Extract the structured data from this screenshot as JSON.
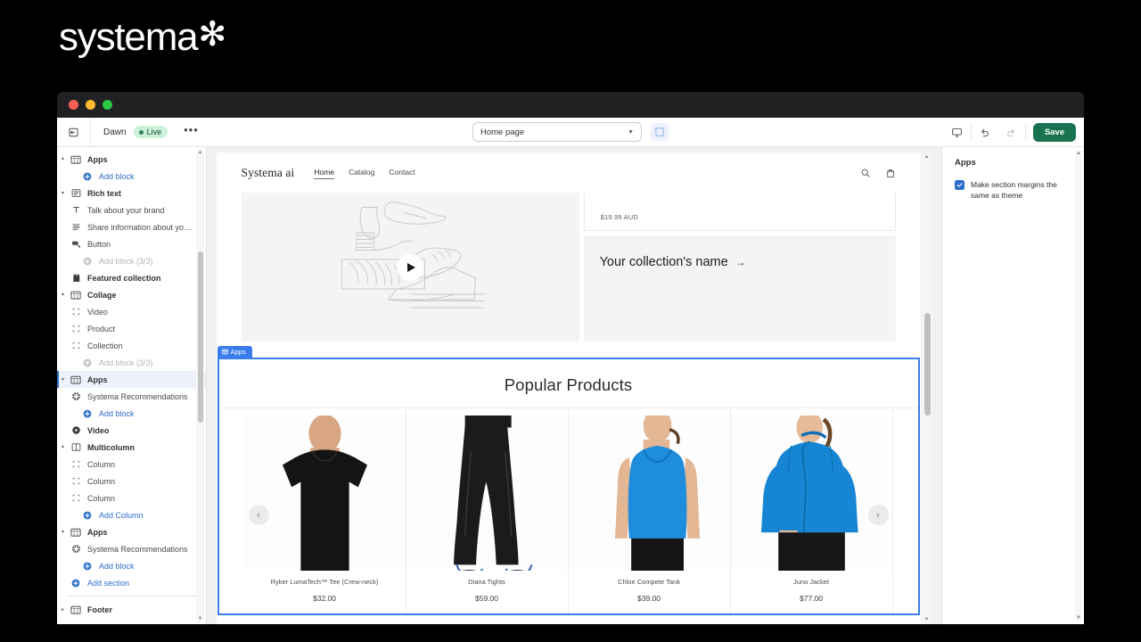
{
  "brand": {
    "name": "systema",
    "star": "✻"
  },
  "toolbar": {
    "exit_icon": "exit-icon",
    "theme_name": "Dawn",
    "live_label": "Live",
    "more_label": "•••",
    "page_selector_value": "Home page",
    "inspect_icon": "inspector-icon",
    "device_icon": "desktop-icon",
    "undo_icon": "undo-icon",
    "redo_icon": "redo-icon",
    "save_label": "Save"
  },
  "sidebar": {
    "items": [
      {
        "label": "Apps",
        "type": "section",
        "icon": "apps-icon",
        "twisty": "▾"
      },
      {
        "label": "Add block",
        "type": "add",
        "icon": "plus-circle-icon"
      },
      {
        "label": "Rich text",
        "type": "section",
        "icon": "richtext-icon",
        "twisty": "▾"
      },
      {
        "label": "Talk about your brand",
        "type": "block",
        "icon": "text-icon"
      },
      {
        "label": "Share information about yo…",
        "type": "block",
        "icon": "paragraph-icon"
      },
      {
        "label": "Button",
        "type": "block",
        "icon": "button-icon"
      },
      {
        "label": "Add block (3/3)",
        "type": "add",
        "disabled": true,
        "icon": "plus-circle-icon"
      },
      {
        "label": "Featured collection",
        "type": "section",
        "icon": "collection-icon",
        "twisty": ""
      },
      {
        "label": "Collage",
        "type": "section",
        "icon": "collage-icon",
        "twisty": "▾"
      },
      {
        "label": "Video",
        "type": "block",
        "icon": "bracket-icon"
      },
      {
        "label": "Product",
        "type": "block",
        "icon": "bracket-icon"
      },
      {
        "label": "Collection",
        "type": "block",
        "icon": "bracket-icon"
      },
      {
        "label": "Add block (3/3)",
        "type": "add",
        "disabled": true,
        "icon": "plus-circle-icon"
      },
      {
        "label": "Apps",
        "type": "section",
        "icon": "apps-icon",
        "twisty": "▾",
        "selected": true
      },
      {
        "label": "Systema Recommendations",
        "type": "block",
        "icon": "systema-icon"
      },
      {
        "label": "Add block",
        "type": "add",
        "icon": "plus-circle-icon"
      },
      {
        "label": "Video",
        "type": "section",
        "icon": "video-icon",
        "twisty": ""
      },
      {
        "label": "Multicolumn",
        "type": "section",
        "icon": "multicolumn-icon",
        "twisty": "▾"
      },
      {
        "label": "Column",
        "type": "block",
        "icon": "bracket-icon"
      },
      {
        "label": "Column",
        "type": "block",
        "icon": "bracket-icon"
      },
      {
        "label": "Column",
        "type": "block",
        "icon": "bracket-icon"
      },
      {
        "label": "Add Column",
        "type": "add",
        "icon": "plus-circle-icon"
      },
      {
        "label": "Apps",
        "type": "section",
        "icon": "apps-icon",
        "twisty": "▾"
      },
      {
        "label": "Systema Recommendations",
        "type": "block",
        "icon": "systema-icon"
      },
      {
        "label": "Add block",
        "type": "add",
        "icon": "plus-circle-icon"
      },
      {
        "label": "Add section",
        "type": "add-root",
        "icon": "plus-circle-icon"
      },
      {
        "separator": true
      },
      {
        "label": "Footer",
        "type": "section",
        "icon": "footer-icon",
        "twisty": "▸"
      }
    ]
  },
  "storefront": {
    "logo": "Systema ai",
    "nav": [
      {
        "label": "Home",
        "active": true
      },
      {
        "label": "Catalog",
        "active": false
      },
      {
        "label": "Contact",
        "active": false
      }
    ],
    "search_icon": "search-icon",
    "cart_icon": "cart-icon",
    "collage": {
      "video_play_icon": "play-icon",
      "product_price": "$19.99 AUD",
      "collection_name": "Your collection's name",
      "collection_arrow": "→"
    },
    "apps_section": {
      "tag_label": "Apps",
      "tag_icon": "apps-icon",
      "title": "Popular Products",
      "prev_icon": "chevron-left-icon",
      "next_icon": "chevron-right-icon",
      "products": [
        {
          "name": "Ryker LumaTech™ Tee (Crew-neck)",
          "price": "$32.00",
          "color": "#141414",
          "kind": "tee"
        },
        {
          "name": "Diana Tights",
          "price": "$59.00",
          "color": "#1b1b1d",
          "kind": "tights"
        },
        {
          "name": "Chloe Compete Tank",
          "price": "$39.00",
          "color": "#1f8ddd",
          "kind": "tank"
        },
        {
          "name": "Juno Jacket",
          "price": "$77.00",
          "color": "#1585d4",
          "kind": "jacket"
        }
      ]
    }
  },
  "right_panel": {
    "title": "Apps",
    "checkbox_label": "Make section margins the same as theme",
    "checkbox_checked": true,
    "accent_color": "#2c6ecb"
  }
}
